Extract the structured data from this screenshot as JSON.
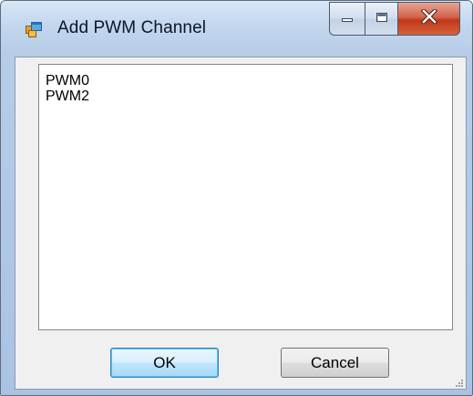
{
  "window": {
    "title": "Add PWM Channel"
  },
  "titlebar": {
    "icon": "form-app-icon",
    "buttons": [
      "minimize-icon",
      "maximize-icon",
      "close-icon"
    ]
  },
  "list": {
    "items": [
      "PWM0",
      "PWM2"
    ]
  },
  "buttons": {
    "ok_label": "OK",
    "cancel_label": "Cancel"
  },
  "colors": {
    "accent": "#3c7fb1",
    "close": "#c0381c",
    "frame": "#b6cde8"
  }
}
